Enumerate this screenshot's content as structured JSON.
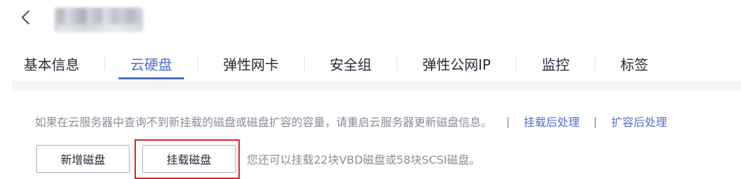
{
  "header": {
    "back_icon": "chevron-left-icon"
  },
  "tabs": [
    {
      "label": "基本信息",
      "active": false
    },
    {
      "label": "云硬盘",
      "active": true
    },
    {
      "label": "弹性网卡",
      "active": false
    },
    {
      "label": "安全组",
      "active": false
    },
    {
      "label": "弹性公网IP",
      "active": false
    },
    {
      "label": "监控",
      "active": false
    },
    {
      "label": "标签",
      "active": false
    }
  ],
  "info": {
    "message": "如果在云服务器中查询不到新挂载的磁盘或磁盘扩容的容量，请重启云服务器更新磁盘信息。",
    "separator": "|",
    "link_attach_post": "挂载后处理",
    "link_expand_post": "扩容后处理"
  },
  "actions": {
    "add_disk_label": "新增磁盘",
    "attach_disk_label": "挂载磁盘",
    "quota_hint": "您还可以挂载22块VBD磁盘或58块SCSI磁盘。"
  },
  "colors": {
    "accent": "#526ecc",
    "text": "#252b3a",
    "muted": "#8a8e99",
    "highlight": "#e02020",
    "content_bg": "#f5f5f7"
  }
}
